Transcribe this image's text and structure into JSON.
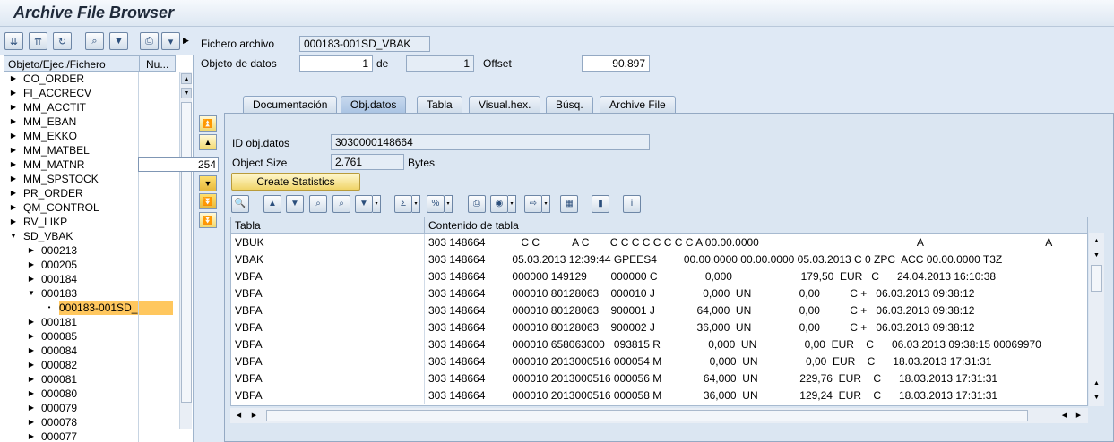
{
  "app": {
    "title": "Archive File Browser"
  },
  "tree": {
    "col_object": "Objeto/Ejec./Fichero",
    "col_num": "Nu...",
    "badge_value": "254",
    "items": [
      {
        "label": "CO_ORDER",
        "level": 0,
        "expanded": false
      },
      {
        "label": "FI_ACCRECV",
        "level": 0,
        "expanded": false
      },
      {
        "label": "MM_ACCTIT",
        "level": 0,
        "expanded": false
      },
      {
        "label": "MM_EBAN",
        "level": 0,
        "expanded": false
      },
      {
        "label": "MM_EKKO",
        "level": 0,
        "expanded": false
      },
      {
        "label": "MM_MATBEL",
        "level": 0,
        "expanded": false
      },
      {
        "label": "MM_MATNR",
        "level": 0,
        "expanded": false
      },
      {
        "label": "MM_SPSTOCK",
        "level": 0,
        "expanded": false
      },
      {
        "label": "PR_ORDER",
        "level": 0,
        "expanded": false
      },
      {
        "label": "QM_CONTROL",
        "level": 0,
        "expanded": false
      },
      {
        "label": "RV_LIKP",
        "level": 0,
        "expanded": false
      },
      {
        "label": "SD_VBAK",
        "level": 0,
        "expanded": true
      },
      {
        "label": "000213",
        "level": 1,
        "expanded": false
      },
      {
        "label": "000205",
        "level": 1,
        "expanded": false
      },
      {
        "label": "000184",
        "level": 1,
        "expanded": false
      },
      {
        "label": "000183",
        "level": 1,
        "expanded": true
      },
      {
        "label": "000183-001SD_",
        "level": 2,
        "expanded": false,
        "selected": true
      },
      {
        "label": "000181",
        "level": 1,
        "expanded": false
      },
      {
        "label": "000085",
        "level": 1,
        "expanded": false
      },
      {
        "label": "000084",
        "level": 1,
        "expanded": false
      },
      {
        "label": "000082",
        "level": 1,
        "expanded": false
      },
      {
        "label": "000081",
        "level": 1,
        "expanded": false
      },
      {
        "label": "000080",
        "level": 1,
        "expanded": false
      },
      {
        "label": "000079",
        "level": 1,
        "expanded": false
      },
      {
        "label": "000078",
        "level": 1,
        "expanded": false
      },
      {
        "label": "000077",
        "level": 1,
        "expanded": false
      }
    ]
  },
  "header": {
    "file_label": "Fichero archivo",
    "file_value": "000183-001SD_VBAK",
    "object_label": "Objeto de datos",
    "object_value": "1",
    "of_label": "de",
    "of_value": "1",
    "offset_label": "Offset",
    "offset_value": "90.897"
  },
  "tabs": [
    {
      "label": "Documentación",
      "active": false
    },
    {
      "label": "Obj.datos",
      "active": true
    },
    {
      "label": "Tabla",
      "active": false
    },
    {
      "label": "Visual.hex.",
      "active": false
    },
    {
      "label": "Búsq.",
      "active": false
    },
    {
      "label": "Archive File",
      "active": false
    }
  ],
  "objdatos": {
    "id_label": "ID obj.datos",
    "id_value": "3030000148664",
    "size_label": "Object Size",
    "size_value": "2.761",
    "size_unit": "Bytes",
    "stats_button": "Create Statistics"
  },
  "grid": {
    "col_table": "Tabla",
    "col_content": "Contenido de tabla",
    "rows": [
      {
        "table": "VBUK",
        "content": "303 148664            C C           A C       C C C C C C C C A 00.00.0000                                                     A                                         A"
      },
      {
        "table": "VBAK",
        "content": "303 148664         05.03.2013 12:39:44 GPEES4         00.00.0000 00.00.0000 05.03.2013 C 0 ZPC  ACC 00.00.0000 T3Z"
      },
      {
        "table": "VBFA",
        "content": "303 148664         000000 149129        000000 C                0,000                       179,50  EUR   C      24.04.2013 16:10:38"
      },
      {
        "table": "VBFA",
        "content": "303 148664         000010 80128063    000010 J                0,000  UN                0,00          C +   06.03.2013 09:38:12"
      },
      {
        "table": "VBFA",
        "content": "303 148664         000010 80128063    900001 J              64,000  UN                0,00          C +   06.03.2013 09:38:12"
      },
      {
        "table": "VBFA",
        "content": "303 148664         000010 80128063    900002 J              36,000  UN                0,00          C +   06.03.2013 09:38:12"
      },
      {
        "table": "VBFA",
        "content": "303 148664         000010 658063000   093815 R                0,000  UN                0,00  EUR    C      06.03.2013 09:38:15 00069970"
      },
      {
        "table": "VBFA",
        "content": "303 148664         000010 2013000516 000054 M                0,000  UN                0,00  EUR    C      18.03.2013 17:31:31"
      },
      {
        "table": "VBFA",
        "content": "303 148664         000010 2013000516 000056 M              64,000  UN              229,76  EUR    C      18.03.2013 17:31:31"
      },
      {
        "table": "VBFA",
        "content": "303 148664         000010 2013000516 000058 M              36,000  UN              129,24  EUR    C      18.03.2013 17:31:31"
      }
    ]
  }
}
